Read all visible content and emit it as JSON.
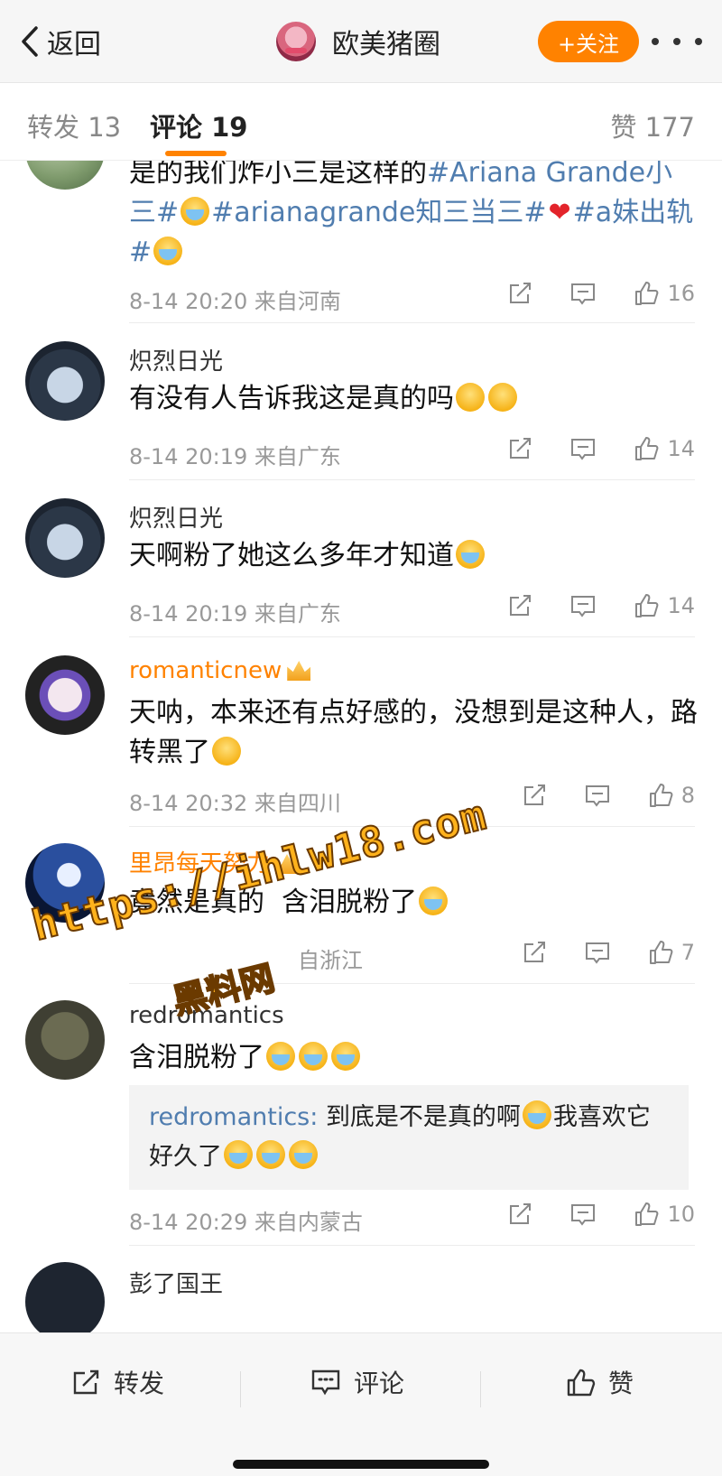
{
  "nav": {
    "back_label": "返回",
    "title": "欧美猪圈",
    "follow_label": "+关注",
    "follow_color": "#ff8200"
  },
  "tabs": {
    "repost": "转发 13",
    "comment": "评论 19",
    "like": "赞 177"
  },
  "comments": [
    {
      "name": "",
      "text_parts": [
        "是的我们炸小三是这样的",
        "#Ariana Grande小三#",
        "#arianagrande知三当三#",
        "#a妹出轨#"
      ],
      "meta": "8-14 20:20 来自河南",
      "likes": "16"
    },
    {
      "name": "炽烈日光",
      "text": "有没有人告诉我这是真的吗",
      "meta": "8-14 20:19 来自广东",
      "likes": "14"
    },
    {
      "name": "炽烈日光",
      "text": "天啊粉了她这么多年才知道",
      "meta": "8-14 20:19 来自广东",
      "likes": "14"
    },
    {
      "name": "romanticnew",
      "text": "天呐，本来还有点好感的，没想到是这种人，路转黑了",
      "meta": "8-14 20:32 来自四川",
      "likes": "8"
    },
    {
      "name": "里昂每天努力",
      "text": "竟然是真的",
      "text_tail": "含泪脱粉了",
      "meta_tail": "自浙江",
      "likes": "7"
    },
    {
      "name": "redromantics",
      "text": "含泪脱粉了",
      "reply_user": "redromantics:",
      "reply_text": "到底是不是真的啊",
      "reply_text2": "我喜欢它",
      "reply_text3": "好久了",
      "meta": "8-14 20:29 来自内蒙古",
      "likes": "10"
    },
    {
      "name": "彭了国王"
    }
  ],
  "watermark": {
    "url": "https://ihlw18.com",
    "label": "黑料网"
  },
  "bottom": {
    "repost": "转发",
    "comment": "评论",
    "like": "赞"
  }
}
